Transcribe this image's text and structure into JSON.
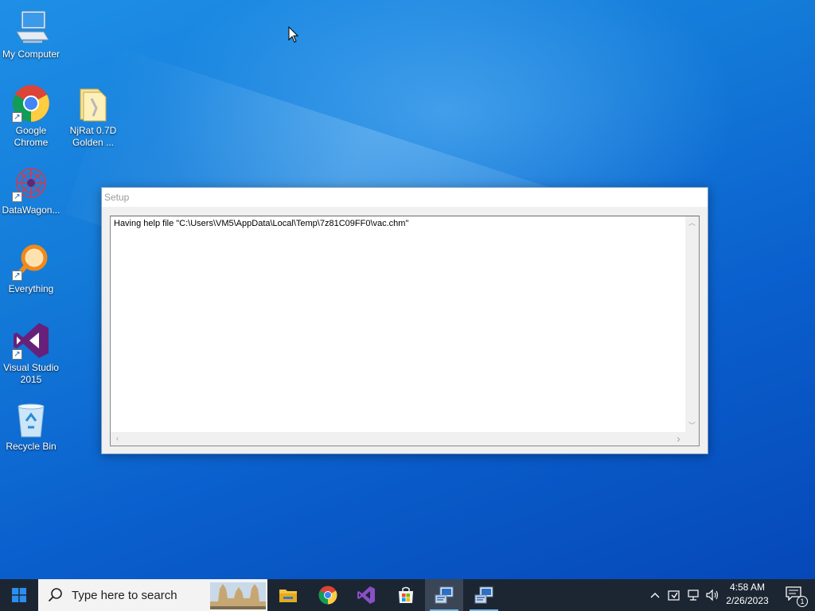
{
  "desktop": {
    "icons": [
      {
        "label_line1": "My Computer",
        "label_line2": "",
        "icon": "computer-icon"
      },
      {
        "label_line1": "Google",
        "label_line2": "Chrome",
        "icon": "chrome-icon"
      },
      {
        "label_line1": "NjRat 0.7D",
        "label_line2": "Golden ...",
        "icon": "folder-icon"
      },
      {
        "label_line1": "DataWagon...",
        "label_line2": "",
        "icon": "datawagon-icon"
      },
      {
        "label_line1": "Everything",
        "label_line2": "",
        "icon": "everything-search-icon"
      },
      {
        "label_line1": "Visual Studio",
        "label_line2": "2015",
        "icon": "visual-studio-icon"
      },
      {
        "label_line1": "Recycle Bin",
        "label_line2": "",
        "icon": "recycle-bin-icon"
      }
    ]
  },
  "setup_window": {
    "title": "Setup",
    "message": "Having help file \"C:\\Users\\VM5\\AppData\\Local\\Temp\\7z81C09FF0\\vac.chm\""
  },
  "taskbar": {
    "search_placeholder": "Type here to search",
    "pinned": [
      "file-explorer-icon",
      "chrome-icon",
      "visual-studio-icon",
      "store-icon",
      "setup-app-icon",
      "setup-app-icon"
    ],
    "clock_time": "4:58 AM",
    "clock_date": "2/26/2023",
    "notification_count": "1"
  },
  "colors": {
    "taskbar_bg": "#1c2633",
    "desktop_blue": "#0a5fd0",
    "window_border": "#7a9fc8"
  }
}
